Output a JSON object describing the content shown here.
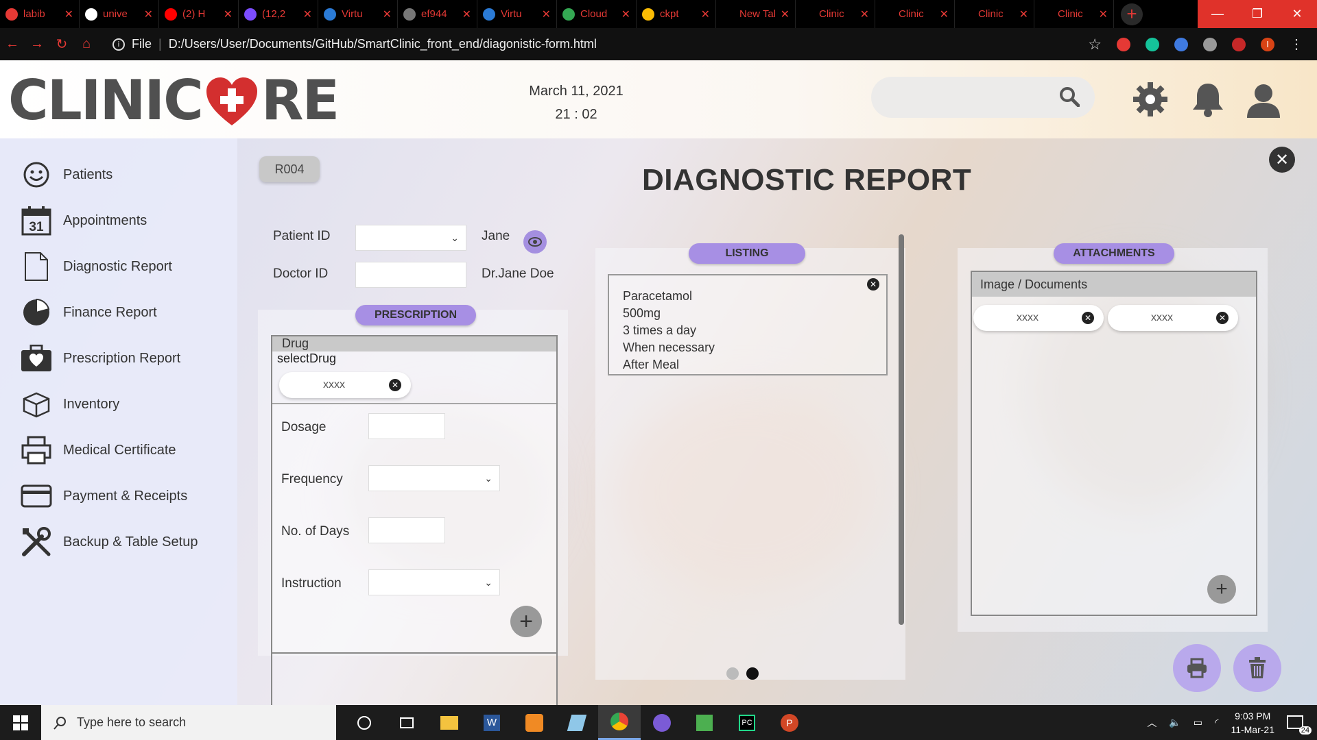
{
  "browser": {
    "tabs": [
      {
        "title": "labib",
        "favicon_color": "#e53935"
      },
      {
        "title": "unive",
        "favicon_color": "#ffffff"
      },
      {
        "title": "(2) H",
        "favicon_color": "#ff0000"
      },
      {
        "title": "(12,2",
        "favicon_color": "#7c4dff"
      },
      {
        "title": "Virtu",
        "favicon_color": "#2b7bd6"
      },
      {
        "title": "ef944",
        "favicon_color": "#777777"
      },
      {
        "title": "Virtu",
        "favicon_color": "#2b7bd6"
      },
      {
        "title": "Cloud",
        "favicon_color": "#34a853"
      },
      {
        "title": "ckpt",
        "favicon_color": "#fbbc04"
      },
      {
        "title": "New Tab",
        "favicon_color": "#000000"
      },
      {
        "title": "Clinic",
        "favicon_color": "#000000"
      },
      {
        "title": "Clinic",
        "favicon_color": "#000000"
      },
      {
        "title": "Clinic",
        "favicon_color": "#000000"
      },
      {
        "title": "Clinic",
        "favicon_color": "#000000"
      }
    ],
    "new_tab": "+",
    "url_scheme": "File",
    "url": "D:/Users/User/Documents/GitHub/SmartClinic_front_end/diagonistic-form.html"
  },
  "header": {
    "logo_left": "CLINIC",
    "logo_right": "RE",
    "date": "March 11, 2021",
    "time": "21 : 02",
    "search_placeholder": ""
  },
  "sidebar": {
    "items": [
      {
        "label": "Patients",
        "icon": "smiley-icon"
      },
      {
        "label": "Appointments",
        "icon": "calendar-icon"
      },
      {
        "label": "Diagnostic Report",
        "icon": "document-icon"
      },
      {
        "label": "Finance Report",
        "icon": "pie-chart-icon"
      },
      {
        "label": "Prescription Report",
        "icon": "medical-bag-icon"
      },
      {
        "label": "Inventory",
        "icon": "box-icon"
      },
      {
        "label": "Medical Certificate",
        "icon": "printer-icon"
      },
      {
        "label": "Payment & Receipts",
        "icon": "credit-card-icon"
      },
      {
        "label": "Backup & Table Setup",
        "icon": "tools-icon"
      }
    ]
  },
  "main": {
    "report_id": "R004",
    "title": "DIAGNOSTIC REPORT",
    "close": "✕",
    "patient_id_label": "Patient ID",
    "patient_name": "Jane",
    "doctor_id_label": "Doctor ID",
    "doctor_name": "Dr.Jane Doe",
    "prescription": {
      "pill": "PRESCRIPTION",
      "drug_header": "Drug",
      "select_drug": "selectDrug",
      "drug_chip": "xxxx",
      "dosage_label": "Dosage",
      "frequency_label": "Frequency",
      "days_label": "No. of Days",
      "instruction_label": "Instruction",
      "add": "+"
    },
    "listing": {
      "pill": "LISTING",
      "lines": [
        "Paracetamol",
        "500mg",
        "3 times a day",
        "When necessary",
        "After Meal"
      ]
    },
    "attachments": {
      "pill": "ATTACHMENTS",
      "header": "Image / Documents",
      "chips": [
        "xxxx",
        "xxxx"
      ],
      "add": "+"
    },
    "pagination": {
      "pages": 2,
      "current": 2
    }
  },
  "taskbar": {
    "search_placeholder": "Type here to search",
    "time": "9:03 PM",
    "date": "11-Mar-21",
    "notifications": "24"
  }
}
